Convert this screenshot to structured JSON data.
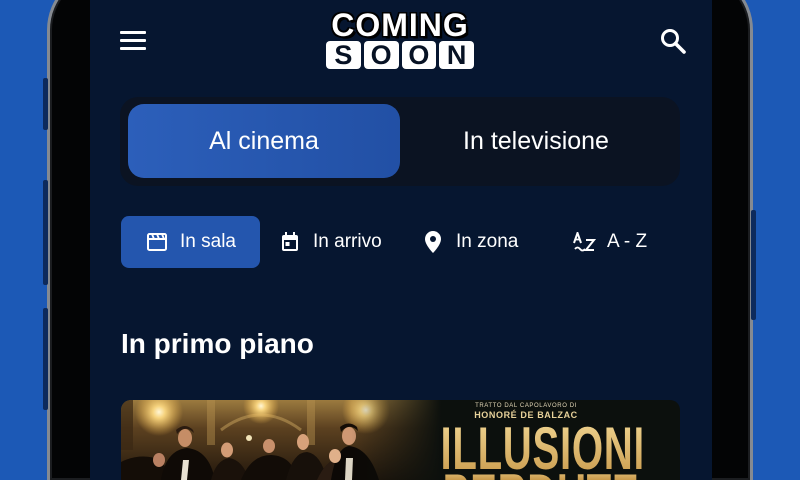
{
  "logo": {
    "top": "COMING",
    "bottom_letters": [
      "S",
      "O",
      "O",
      "N"
    ]
  },
  "header": {
    "menu_icon": "hamburger-menu-icon",
    "search_icon": "search-icon"
  },
  "segmented": {
    "tabs": [
      {
        "label": "Al cinema",
        "selected": true
      },
      {
        "label": "In televisione",
        "selected": false
      }
    ]
  },
  "filters": [
    {
      "label": "In sala",
      "icon": "movie-clapper-icon",
      "selected": true
    },
    {
      "label": "In arrivo",
      "icon": "calendar-icon",
      "selected": false
    },
    {
      "label": "In zona",
      "icon": "location-pin-icon",
      "selected": false
    },
    {
      "label": "A - Z",
      "icon": "sort-by-alpha-icon",
      "selected": false
    }
  ],
  "section": {
    "title": "In primo piano"
  },
  "featured": {
    "poster_caption": "TRATTO DAL CAPOLAVORO DI",
    "poster_author": "HONORÉ DE BALZAC",
    "poster_title_line1": "ILLUSIONI",
    "poster_title_line2": "PERDUTE"
  },
  "colors": {
    "page_background": "#1c59b6",
    "screen_background": "#061630",
    "accent": "#2456ae",
    "poster_gold": "#d8b56c"
  }
}
